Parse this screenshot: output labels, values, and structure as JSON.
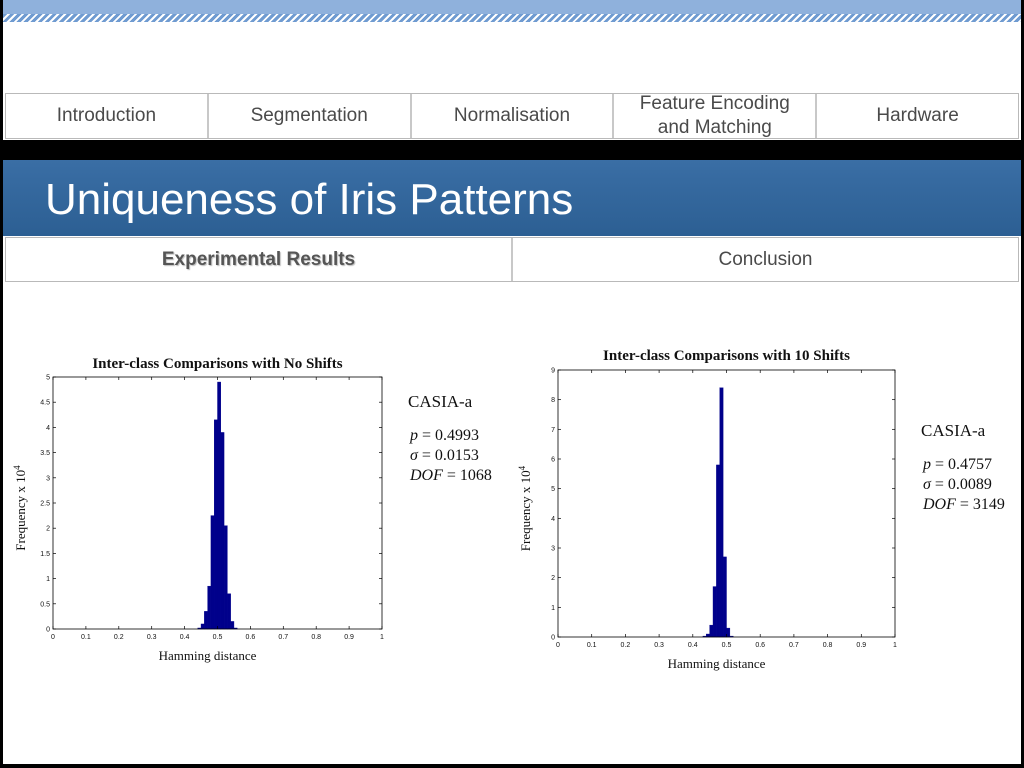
{
  "nav": {
    "items": [
      "Introduction",
      "Segmentation",
      "Normalisation",
      "Feature Encoding and Matching",
      "Hardware"
    ]
  },
  "title": "Uniqueness of Iris Patterns",
  "subnav": {
    "items": [
      "Experimental Results",
      "Conclusion"
    ],
    "active": "Experimental Results"
  },
  "colors": {
    "title_bar": "#2f6399",
    "bar_fill": "#00008b"
  },
  "chart_data": [
    {
      "type": "bar",
      "title": "Inter-class Comparisons with No Shifts",
      "xlabel": "Hamming distance",
      "ylabel": "Frequency x 10",
      "ylabel_exp": "4",
      "xlim": [
        0,
        1
      ],
      "ylim": [
        0,
        5
      ],
      "xticks": [
        "0",
        "0.1",
        "0.2",
        "0.3",
        "0.4",
        "0.5",
        "0.6",
        "0.7",
        "0.8",
        "0.9",
        "1"
      ],
      "yticks": [
        "0",
        "0.5",
        "1",
        "1.5",
        "2",
        "2.5",
        "3",
        "3.5",
        "4",
        "4.5",
        "5"
      ],
      "bin_width": 0.01,
      "x": [
        0.44,
        0.45,
        0.46,
        0.47,
        0.48,
        0.49,
        0.5,
        0.51,
        0.52,
        0.53,
        0.54,
        0.55
      ],
      "values": [
        0.02,
        0.1,
        0.35,
        0.85,
        2.25,
        4.15,
        4.9,
        3.9,
        2.05,
        0.7,
        0.15,
        0.02
      ],
      "stats": {
        "dataset": "CASIA-a",
        "p_label": "p",
        "p_value": " = 0.4993",
        "sigma_label": "σ",
        "sigma_value": " = 0.0153",
        "dof_label": "DOF",
        "dof_value": " = 1068"
      }
    },
    {
      "type": "bar",
      "title": "Inter-class Comparisons with 10 Shifts",
      "xlabel": "Hamming distance",
      "ylabel": "Frequency x 10",
      "ylabel_exp": "4",
      "xlim": [
        0,
        1
      ],
      "ylim": [
        0,
        9
      ],
      "xticks": [
        "0",
        "0.1",
        "0.2",
        "0.3",
        "0.4",
        "0.5",
        "0.6",
        "0.7",
        "0.8",
        "0.9",
        "1"
      ],
      "yticks": [
        "0",
        "1",
        "2",
        "3",
        "4",
        "5",
        "6",
        "7",
        "8",
        "9"
      ],
      "bin_width": 0.01,
      "x": [
        0.43,
        0.44,
        0.45,
        0.46,
        0.47,
        0.48,
        0.49,
        0.5,
        0.51
      ],
      "values": [
        0.03,
        0.1,
        0.4,
        1.7,
        5.8,
        8.4,
        2.7,
        0.3,
        0.03
      ],
      "stats": {
        "dataset": "CASIA-a",
        "p_label": "p",
        "p_value": " = 0.4757",
        "sigma_label": "σ",
        "sigma_value": " = 0.0089",
        "dof_label": "DOF",
        "dof_value": " = 3149"
      }
    }
  ]
}
